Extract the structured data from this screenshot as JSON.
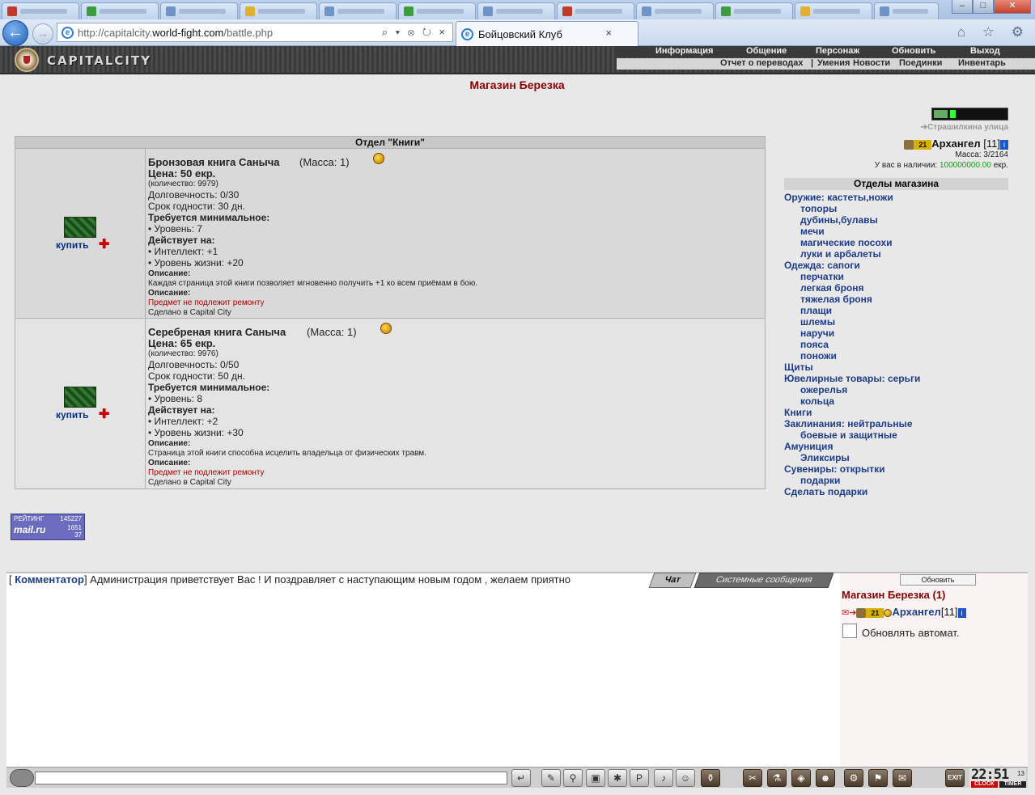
{
  "browser": {
    "url_prefix": "http://capitalcity.",
    "url_domain": "world-fight.com",
    "url_path": "/battle.php",
    "tab_title": "Бойцовский Клуб",
    "tab_close": "×",
    "addr_controls": "⌕ ▾ ⊗ ↻ ×",
    "right_icons": "⌂ ☆ ⚙"
  },
  "game": {
    "logo_text": "CAPITALCITY",
    "menu_top": [
      "Информация",
      "Общение",
      "Персонаж",
      "Обновить",
      "Выход"
    ],
    "menu_bottom": [
      "Отчет о переводах",
      "Умения",
      "Новости",
      "Поединки",
      "Инвентарь"
    ]
  },
  "shop": {
    "title": "Магазин Березка",
    "dept_title": "Отдел \"Книги\"",
    "buy_label": "купить",
    "items": [
      {
        "name": "Бронзовая книга Саныча",
        "mass": "(Масса: 1)",
        "price": "Цена: 50 екр.",
        "qty": "(количество: 9979)",
        "durability": "Долговечность: 0/30",
        "expiry": "Срок годности: 30 дн.",
        "req_head": "Требуется минимальное:",
        "req_level": "• Уровень: 7",
        "acts_head": "Действует на:",
        "act1": "• Интеллект: +1",
        "act2": "• Уровень жизни: +20",
        "desc_head": "Описание:",
        "desc": "Каждая страница этой книги позволяет мгновенно получить +1 ко всем приёмам в бою.",
        "desc_head2": "Описание:",
        "repair": "Предмет не подлежит ремонту",
        "made": "Сделано в Capital City"
      },
      {
        "name": "Серебреная книга Саныча",
        "mass": "(Масса: 1)",
        "price": "Цена: 65 екр.",
        "qty": "(количество: 9976)",
        "durability": "Долговечность: 0/50",
        "expiry": "Срок годности: 50 дн.",
        "req_head": "Требуется минимальное:",
        "req_level": "• Уровень: 8",
        "acts_head": "Действует на:",
        "act1": "• Интеллект: +2",
        "act2": "• Уровень жизни: +30",
        "desc_head": "Описание:",
        "desc": "Страница этой книги способна исцелить владельца от физических травм.",
        "desc_head2": "Описание:",
        "repair": "Предмет не подлежит ремонту",
        "made": "Сделано в Capital City"
      }
    ]
  },
  "player": {
    "street": "➔Страшилкина улица",
    "rank_badge": "21",
    "name": "Архангел",
    "level": "[11]",
    "info_icon": "i",
    "mass": "Масса: 3/2164",
    "money_label": "У вас в наличии:",
    "money_value": "100000000.00",
    "money_unit": "екр."
  },
  "departments": {
    "title": "Отделы магазина",
    "items": [
      "Оружие: кастеты,ножи",
      "топоры",
      "дубины,булавы",
      "мечи",
      "магические посохи",
      "луки и арбалеты",
      "Одежда: сапоги",
      "перчатки",
      "легкая броня",
      "тяжелая броня",
      "плащи",
      "шлемы",
      "наручи",
      "пояса",
      "поножи",
      "Щиты",
      "Ювелирные товары: серьги",
      "ожерелья",
      "кольца",
      "Книги",
      "Заклинания: нейтральные",
      "боевые и защитные",
      "Амуниция",
      "Эликсиры",
      "Сувениры: открытки",
      "подарки",
      "Сделать подарки"
    ]
  },
  "rating": {
    "label": "РЕЙТИНГ",
    "n1": "145227",
    "brand": "mail.ru",
    "n2": "1651",
    "n3": "37"
  },
  "chat": {
    "open_bracket": "[ ",
    "author": "Комментатор",
    "close_bracket": "] ",
    "message": "Администрация приветствует Вас ! И поздравляет с наступающим новым годом , желаем приятно",
    "tab_chat": "Чат",
    "tab_system": "Системные сообщения",
    "refresh": "Обновить",
    "room": "Магазин Березка (1)",
    "auto_refresh": "Обновлять автомат."
  },
  "clock": {
    "time": "22:51",
    "seconds": "13",
    "clock_label": "CLOCK",
    "timer_label": "TIMER"
  },
  "toolbar": {
    "icons": [
      "↵",
      "✎",
      "⚲",
      "▣",
      "✱",
      "P",
      "♪",
      "☺",
      "⚱",
      "✂",
      "⚗",
      "◈",
      "☻",
      "⚙",
      "⚑",
      "✉",
      "EXIT"
    ]
  }
}
